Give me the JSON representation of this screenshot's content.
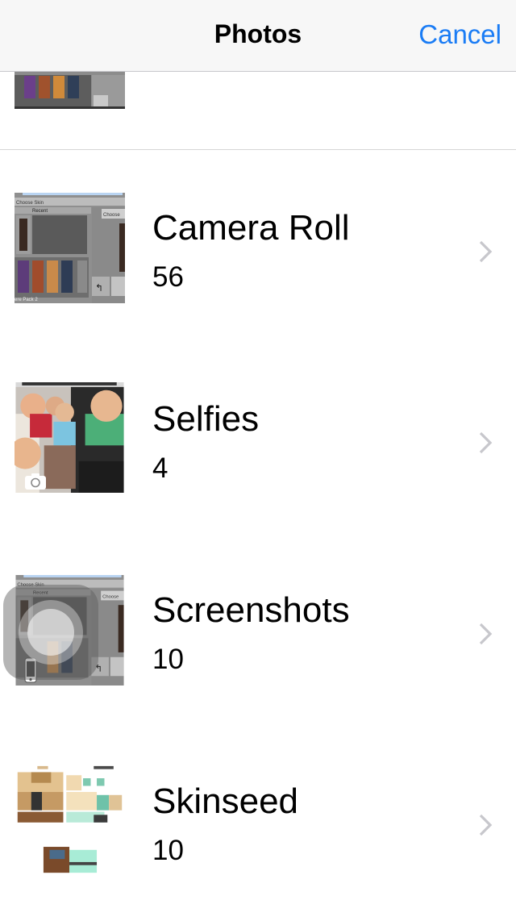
{
  "navbar": {
    "title": "Photos",
    "cancel_label": "Cancel"
  },
  "albums": [
    {
      "title": "Camera Roll",
      "count": "56",
      "thumb_icon": "game-screenshot-thumbnail"
    },
    {
      "title": "Selfies",
      "count": "4",
      "thumb_icon": "selfie-photo-thumbnail",
      "badge_icon": "front-camera-icon"
    },
    {
      "title": "Screenshots",
      "count": "10",
      "thumb_icon": "game-screenshot-thumbnail",
      "badge_icon": "iphone-icon"
    },
    {
      "title": "Skinseed",
      "count": "10",
      "thumb_icon": "minecraft-skin-thumbnail"
    }
  ],
  "thumbnail_text": {
    "choose_skin": "Choose Skin",
    "recent": "Recent",
    "choose": "Choose",
    "pack": "ere Pack 2",
    "back_arrow": "↰",
    "co": "Co"
  },
  "colors": {
    "accent": "#1a7cf5",
    "chevron": "#c7c7cc",
    "separator": "#d6d6d6"
  }
}
